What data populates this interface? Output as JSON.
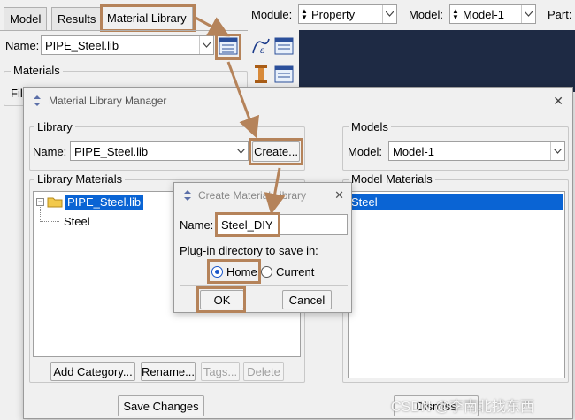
{
  "main": {
    "tabs": [
      {
        "label": "Model"
      },
      {
        "label": "Results"
      },
      {
        "label": "Material Library"
      }
    ],
    "name_label": "Name:",
    "name_value": "PIPE_Steel.lib",
    "materials_label": "Materials",
    "filter_label": "Fil"
  },
  "toolbar": {
    "module_label": "Module:",
    "module_value": "Property",
    "model_label": "Model:",
    "model_value": "Model-1",
    "part_label": "Part:"
  },
  "manager": {
    "title": "Material Library Manager",
    "library_group": "Library",
    "name_label": "Name:",
    "name_value": "PIPE_Steel.lib",
    "create_button": "Create...",
    "models_group": "Models",
    "model_label": "Model:",
    "model_value": "Model-1",
    "library_materials": "Library Materials",
    "model_materials": "Model Materials",
    "tree": {
      "root": "PIPE_Steel.lib",
      "child": "Steel"
    },
    "model_list": [
      "Steel"
    ],
    "buttons": {
      "add_category": "Add Category...",
      "rename": "Rename...",
      "tags": "Tags...",
      "delete": "Delete"
    },
    "save_changes": "Save Changes",
    "dismiss": "Dismiss"
  },
  "create_dialog": {
    "title": "Create Material Library",
    "name_label": "Name:",
    "name_value": "Steel_DIY",
    "plugin_label": "Plug-in directory to save in:",
    "options": {
      "home": "Home",
      "current": "Current"
    },
    "selected": "home",
    "ok": "OK",
    "cancel": "Cancel"
  },
  "watermark": "CSDN @李南北找东西",
  "colors": {
    "highlight": "#b5835a",
    "selection": "#0a64d4",
    "dark_panel": "#1e2a44"
  }
}
